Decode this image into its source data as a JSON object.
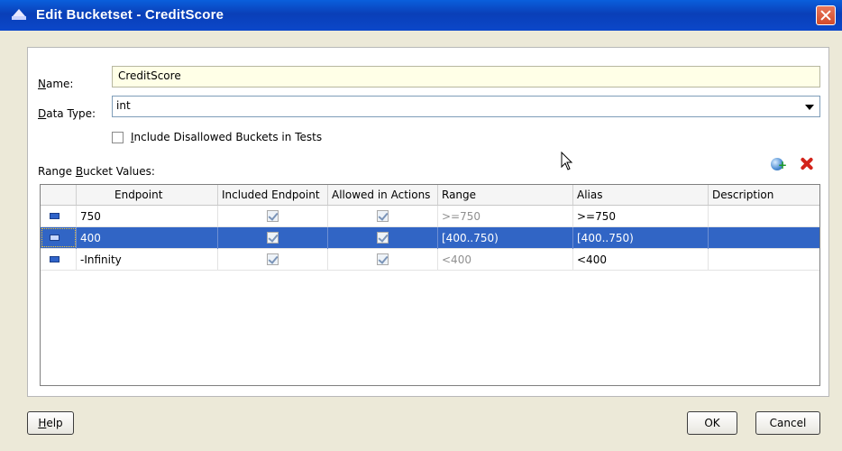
{
  "window": {
    "title": "Edit Bucketset - CreditScore"
  },
  "form": {
    "name_label_u": "N",
    "name_label_rest": "ame:",
    "name_value": "CreditScore",
    "type_label_u": "D",
    "type_label_rest": "ata Type:",
    "type_value": "int",
    "include_label_u": "I",
    "include_label_rest": "nclude Disallowed Buckets in Tests",
    "range_label_pre": "Range ",
    "range_label_u": "B",
    "range_label_rest": "ucket Values:"
  },
  "table": {
    "columns": [
      "Endpoint",
      "Included Endpoint",
      "Allowed in Actions",
      "Range",
      "Alias",
      "Description"
    ],
    "rows": [
      {
        "endpoint": "750",
        "range": ">=750",
        "alias": ">=750",
        "description": ""
      },
      {
        "endpoint": "400",
        "range": "[400..750)",
        "alias": "[400..750)",
        "description": ""
      },
      {
        "endpoint": "-Infinity",
        "range": "<400",
        "alias": "<400",
        "description": ""
      }
    ]
  },
  "buttons": {
    "help_u": "H",
    "help_rest": "elp",
    "ok": "OK",
    "cancel": "Cancel"
  },
  "icons": {
    "title": "dialog-icon",
    "add": "add-bucket-icon",
    "delete": "delete-bucket-icon",
    "row": "bucket-row-icon"
  },
  "colors": {
    "titlebar": "#0a3fb8",
    "selection": "#3165c5",
    "name_field_bg": "#ffffe7",
    "dialog_bg": "#ece9d8"
  }
}
